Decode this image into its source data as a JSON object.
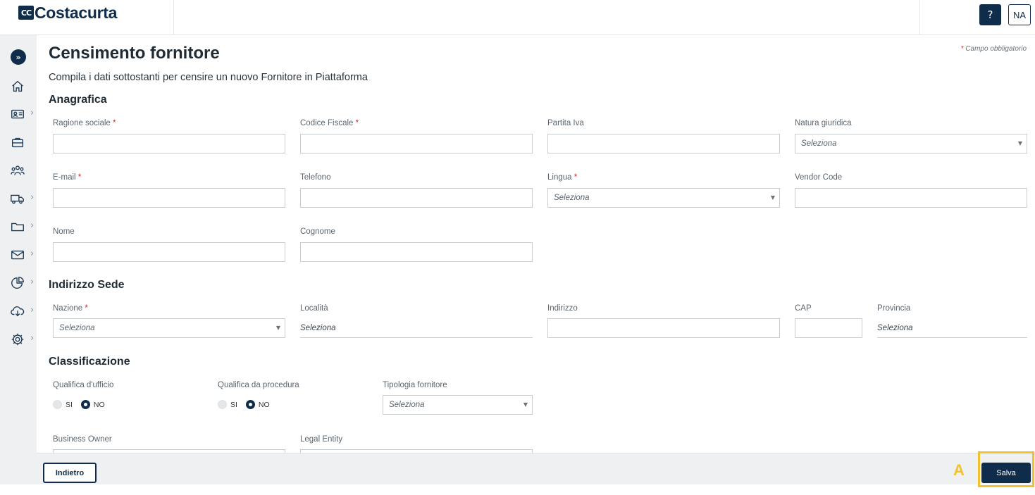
{
  "header": {
    "logo_mark": "CC",
    "logo_text": "Costacurta",
    "help_label": "?",
    "user_initials": "NA"
  },
  "sidebar": {
    "items": [
      {
        "icon": "home-icon",
        "has_submenu": false
      },
      {
        "icon": "id-card-icon",
        "has_submenu": true
      },
      {
        "icon": "briefcase-icon",
        "has_submenu": false
      },
      {
        "icon": "users-icon",
        "has_submenu": false
      },
      {
        "icon": "truck-icon",
        "has_submenu": true
      },
      {
        "icon": "folder-icon",
        "has_submenu": true
      },
      {
        "icon": "mail-icon",
        "has_submenu": true
      },
      {
        "icon": "pie-chart-icon",
        "has_submenu": true
      },
      {
        "icon": "cloud-download-icon",
        "has_submenu": true
      },
      {
        "icon": "gear-icon",
        "has_submenu": true
      }
    ]
  },
  "page": {
    "title": "Censimento fornitore",
    "required_note_star": "*",
    "required_note": "Campo obbligatorio",
    "subtitle": "Compila i dati sottostanti per censire un nuovo Fornitore in Piattaforma"
  },
  "anagrafica": {
    "title": "Anagrafica",
    "ragione_sociale": {
      "label": "Ragione sociale",
      "value": ""
    },
    "codice_fiscale": {
      "label": "Codice Fiscale",
      "value": ""
    },
    "partita_iva": {
      "label": "Partita Iva",
      "value": ""
    },
    "natura_giuridica": {
      "label": "Natura giuridica",
      "value": "Seleziona"
    },
    "email": {
      "label": "E-mail",
      "value": ""
    },
    "telefono": {
      "label": "Telefono",
      "value": ""
    },
    "lingua": {
      "label": "Lingua",
      "value": "Seleziona"
    },
    "vendor_code": {
      "label": "Vendor Code",
      "value": ""
    },
    "nome": {
      "label": "Nome",
      "value": ""
    },
    "cognome": {
      "label": "Cognome",
      "value": ""
    }
  },
  "indirizzo": {
    "title": "Indirizzo Sede",
    "nazione": {
      "label": "Nazione",
      "value": "Seleziona"
    },
    "localita": {
      "label": "Località",
      "value": "Seleziona"
    },
    "indirizzo": {
      "label": "Indirizzo",
      "value": ""
    },
    "cap": {
      "label": "CAP",
      "value": ""
    },
    "provincia": {
      "label": "Provincia",
      "value": "Seleziona"
    }
  },
  "classificazione": {
    "title": "Classificazione",
    "qualifica_ufficio": {
      "label": "Qualifica d'ufficio",
      "option_yes": "SI",
      "option_no": "NO",
      "selected": "NO"
    },
    "qualifica_procedura": {
      "label": "Qualifica da procedura",
      "option_yes": "SI",
      "option_no": "NO",
      "selected": "NO"
    },
    "tipologia_fornitore": {
      "label": "Tipologia fornitore",
      "value": "Seleziona"
    },
    "business_owner": {
      "label": "Business Owner"
    },
    "legal_entity": {
      "label": "Legal Entity"
    }
  },
  "footer": {
    "back_label": "Indietro",
    "save_label": "Salva"
  },
  "annotation": {
    "marker": "A",
    "color": "#f2c12e"
  },
  "colors": {
    "primary": "#0f2d4a",
    "required": "#c62828",
    "sidebar_bg": "#eef0f2"
  }
}
